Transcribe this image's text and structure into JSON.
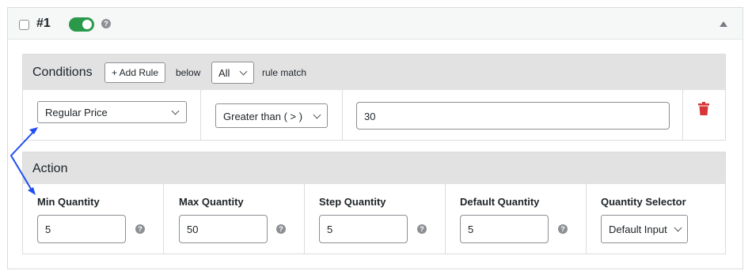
{
  "rule": {
    "number": "#1",
    "enabled": true,
    "help_glyph": "?",
    "collapse_icon": "triangle-up-icon"
  },
  "conditions": {
    "title": "Conditions",
    "add_rule_label": "+ Add Rule",
    "below_label": "below",
    "match_selected": "All",
    "rule_match_label": "rule match",
    "row": {
      "field": "Regular Price",
      "operator": "Greater than ( > )",
      "value": "30",
      "delete_icon": "trash-icon"
    }
  },
  "action": {
    "title": "Action",
    "columns": [
      {
        "label": "Min Quantity",
        "value": "5"
      },
      {
        "label": "Max Quantity",
        "value": "50"
      },
      {
        "label": "Step Quantity",
        "value": "5"
      },
      {
        "label": "Default Quantity",
        "value": "5"
      },
      {
        "label": "Quantity Selector",
        "value": "Default Input"
      }
    ]
  },
  "colors": {
    "toggle_on": "#2a9a4a",
    "delete": "#d63638",
    "annotation_arrow": "#1f4ef0"
  }
}
